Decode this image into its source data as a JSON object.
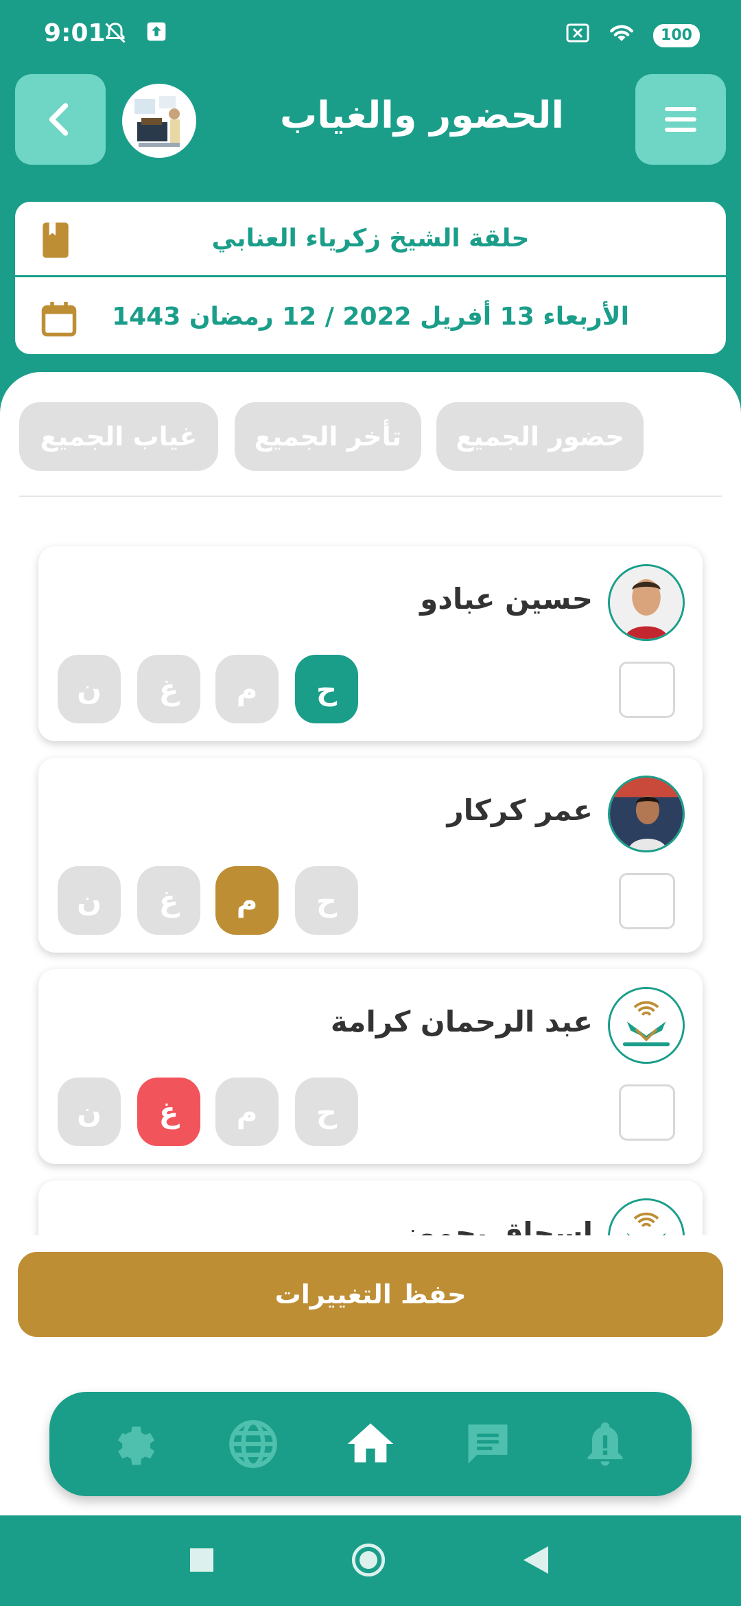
{
  "status_bar": {
    "time": "9:01",
    "battery": "100"
  },
  "header": {
    "title": "الحضور والغياب"
  },
  "info": {
    "circle_name": "حلقة الشيخ زكرياء العنابي",
    "date": "الأربعاء 13 أفريل 2022 / 12 رمضان 1443"
  },
  "bulk_actions": {
    "all_present": "حضور الجميع",
    "all_late": "تأخر الجميع",
    "all_absent": "غياب الجميع"
  },
  "status_labels": {
    "present": "ح",
    "late": "م",
    "absent": "غ",
    "excused": "ن"
  },
  "students": [
    {
      "name": "حسين عبادو",
      "selected_status": "present"
    },
    {
      "name": "عمر كركار",
      "selected_status": "late"
    },
    {
      "name": "عبد الرحمان كرامة",
      "selected_status": "absent"
    },
    {
      "name": "إسحاق بحموز",
      "selected_status": ""
    }
  ],
  "save_label": "حفظ التغييرات",
  "bottom_nav": [
    "gear-icon",
    "globe-icon",
    "home-icon",
    "chat-icon",
    "bell-icon"
  ],
  "colors": {
    "primary": "#1a9e8a",
    "gold": "#be8e35",
    "red": "#f2545b",
    "grey": "#e0e0e0"
  }
}
